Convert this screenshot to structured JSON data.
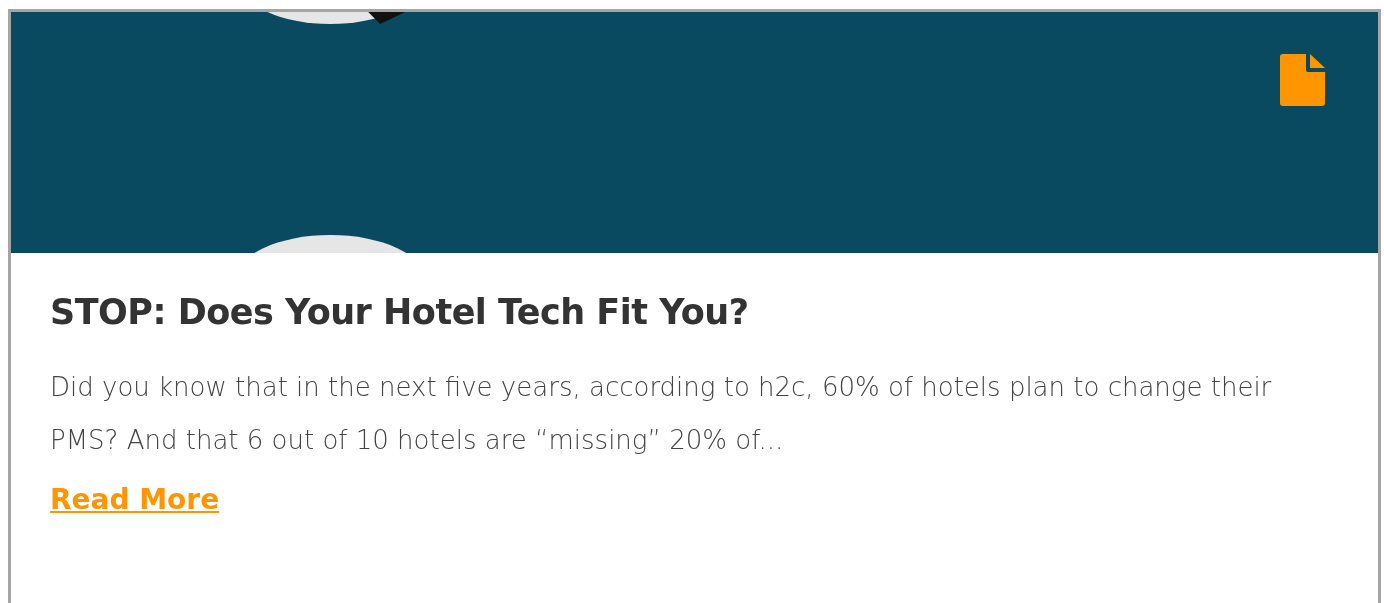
{
  "card": {
    "title": "STOP: Does Your Hotel Tech Fit You?",
    "excerpt": "Did you know that in the next five years, according to h2c, 60% of hotels plan to change their PMS? And that 6 out of 10 hotels are “missing” 20% of...",
    "link": "Read More"
  }
}
